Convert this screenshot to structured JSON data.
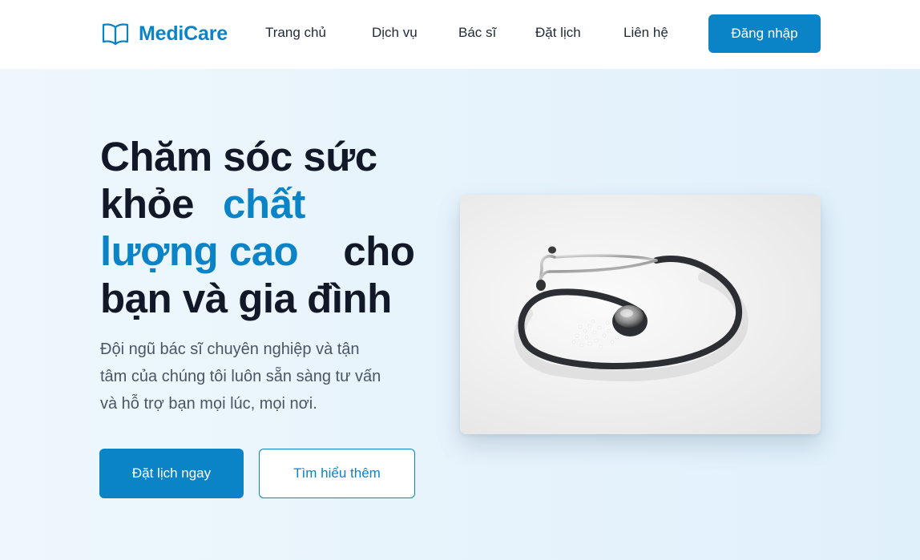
{
  "header": {
    "logo_text": "MediCare",
    "logo_icon": "open-book-icon",
    "nav": [
      {
        "label": "Trang chủ"
      },
      {
        "label": "Dịch vụ"
      },
      {
        "label": "Bác sĩ"
      },
      {
        "label": "Đặt lịch"
      },
      {
        "label": "Liên hệ"
      }
    ],
    "login_label": "Đăng nhập"
  },
  "hero": {
    "headline": {
      "line1": "Chăm sóc sức",
      "line2_plain": "khỏe",
      "line2_accent": "chất",
      "line3_accent": "lượng cao",
      "line3_plain": "cho",
      "line4": "bạn và gia đình"
    },
    "subtext": {
      "line1": "Đội ngũ bác sĩ chuyên nghiệp và tận",
      "line2": "tâm của chúng tôi luôn sẵn sàng tư vấn",
      "line3": "và hỗ trợ bạn mọi lúc, mọi nơi."
    },
    "primary_button": "Đặt lịch ngay",
    "secondary_button": "Tìm hiểu thêm",
    "image_subject": "stethoscope-photo"
  },
  "colors": {
    "accent": "#0a84c6",
    "heading": "#111827",
    "body_text": "#4b5563",
    "hero_bg": "#e8f4fc"
  }
}
